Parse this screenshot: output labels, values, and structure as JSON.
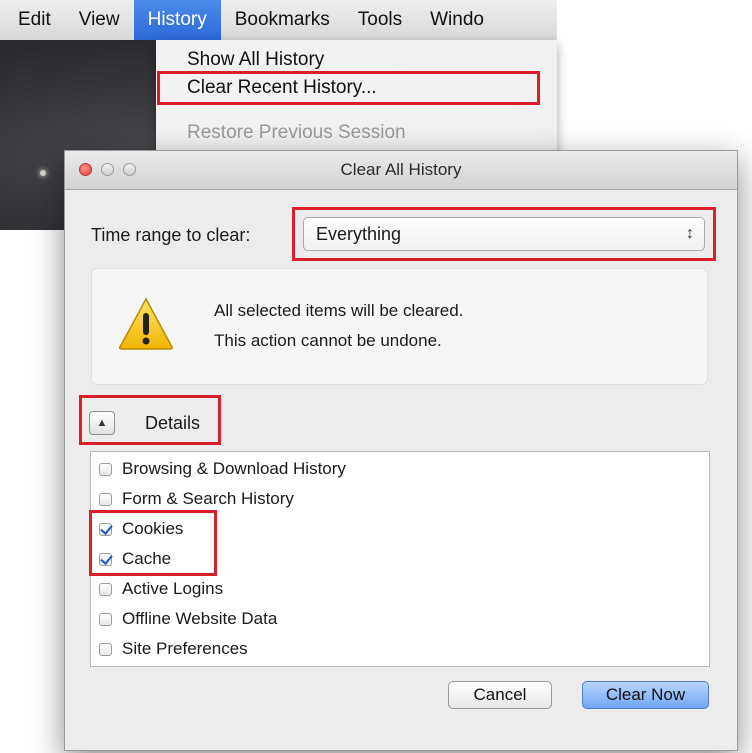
{
  "menubar": {
    "items": [
      "Edit",
      "View",
      "History",
      "Bookmarks",
      "Tools",
      "Windo"
    ],
    "active_index": 2
  },
  "history_menu": {
    "items": [
      {
        "label": "Show All History",
        "enabled": true
      },
      {
        "label": "Clear Recent History...",
        "enabled": true
      },
      {
        "label": "Restore Previous Session",
        "enabled": false
      }
    ]
  },
  "dialog": {
    "title": "Clear All History",
    "time_range_label": "Time range to clear:",
    "time_range_value": "Everything",
    "warning_line1": "All selected items will be cleared.",
    "warning_line2": "This action cannot be undone.",
    "details_label": "Details",
    "items": [
      {
        "label": "Browsing & Download History",
        "checked": false
      },
      {
        "label": "Form & Search History",
        "checked": false
      },
      {
        "label": "Cookies",
        "checked": true
      },
      {
        "label": "Cache",
        "checked": true
      },
      {
        "label": "Active Logins",
        "checked": false
      },
      {
        "label": "Offline Website Data",
        "checked": false
      },
      {
        "label": "Site Preferences",
        "checked": false
      }
    ],
    "cancel_label": "Cancel",
    "clear_label": "Clear Now"
  },
  "colors": {
    "highlight": "#d9202a",
    "menu_active": "#2c69d8",
    "checkmark": "#1f56b8"
  },
  "icons": [
    "warning-icon",
    "disclosure-triangle-icon",
    "updown-arrows-icon"
  ]
}
